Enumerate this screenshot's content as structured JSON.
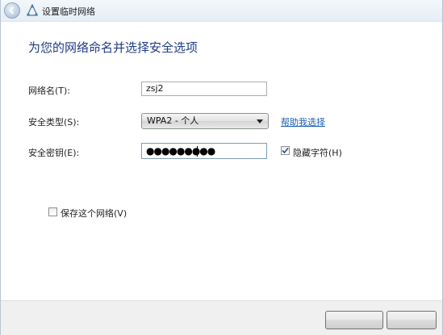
{
  "window": {
    "title": "设置临时网络"
  },
  "page": {
    "heading": "为您的网络命名并选择安全选项"
  },
  "form": {
    "network_name_label": "网络名(T):",
    "network_name_value": "zsj2",
    "security_type_label": "安全类型(S):",
    "security_type_value": "WPA2 - 个人",
    "help_link": "帮助我选择",
    "security_key_label": "安全密钥(E):",
    "security_key_value": "●●●●●●●●●",
    "hide_chars_label": "隐藏字符(H)",
    "hide_chars_checked": true,
    "save_network_label": "保存这个网络(V)",
    "save_network_checked": false
  },
  "icons": {
    "back": "back-arrow-icon",
    "network": "adhoc-network-icon",
    "dropdown": "chevron-down-icon"
  }
}
